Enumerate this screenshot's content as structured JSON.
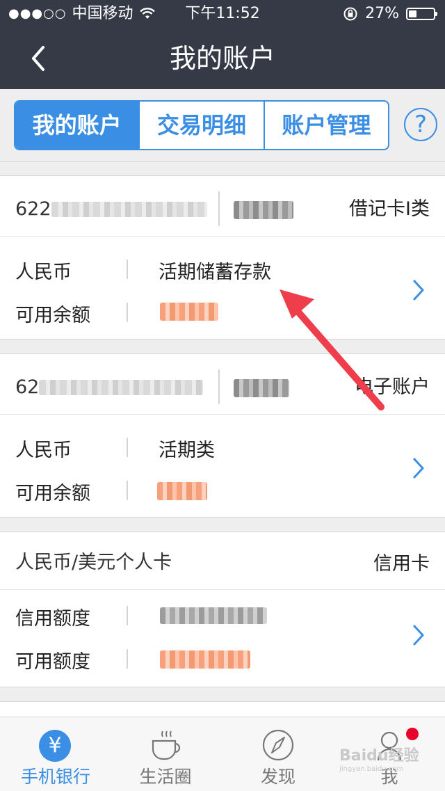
{
  "status_bar": {
    "signal": "●●●○○",
    "carrier": "中国移动",
    "time": "下午11:52",
    "battery": "27%"
  },
  "nav": {
    "title": "我的账户"
  },
  "tabs": [
    {
      "label": "我的账户",
      "active": true
    },
    {
      "label": "交易明细",
      "active": false
    },
    {
      "label": "账户管理",
      "active": false
    }
  ],
  "help_label": "?",
  "accounts": [
    {
      "number_prefix": "622",
      "card_type": "借记卡I类",
      "rows": [
        {
          "label": "人民币",
          "value": "活期储蓄存款"
        },
        {
          "label": "可用余额",
          "value": ""
        }
      ]
    },
    {
      "number_prefix": "62",
      "card_type": "电子账户",
      "rows": [
        {
          "label": "人民币",
          "value": "活期类"
        },
        {
          "label": "可用余额",
          "value": ""
        }
      ]
    },
    {
      "name": "人民币/美元个人卡",
      "card_type": "信用卡",
      "rows": [
        {
          "label": "信用额度",
          "value": ""
        },
        {
          "label": "可用额度",
          "value": ""
        }
      ]
    }
  ],
  "tabbar": [
    {
      "label": "手机银行",
      "icon": "yuan-icon",
      "active": true
    },
    {
      "label": "生活圈",
      "icon": "coffee-cup-icon",
      "active": false
    },
    {
      "label": "发现",
      "icon": "compass-icon",
      "active": false
    },
    {
      "label": "我",
      "icon": "person-icon",
      "active": false
    }
  ],
  "watermark": {
    "text": "Baidu经验",
    "url": "jingyan.baidu.com"
  },
  "colors": {
    "accent": "#3a8fe4",
    "header": "#353a46",
    "badge": "#e8002a",
    "arrow": "#ee3d4b"
  }
}
